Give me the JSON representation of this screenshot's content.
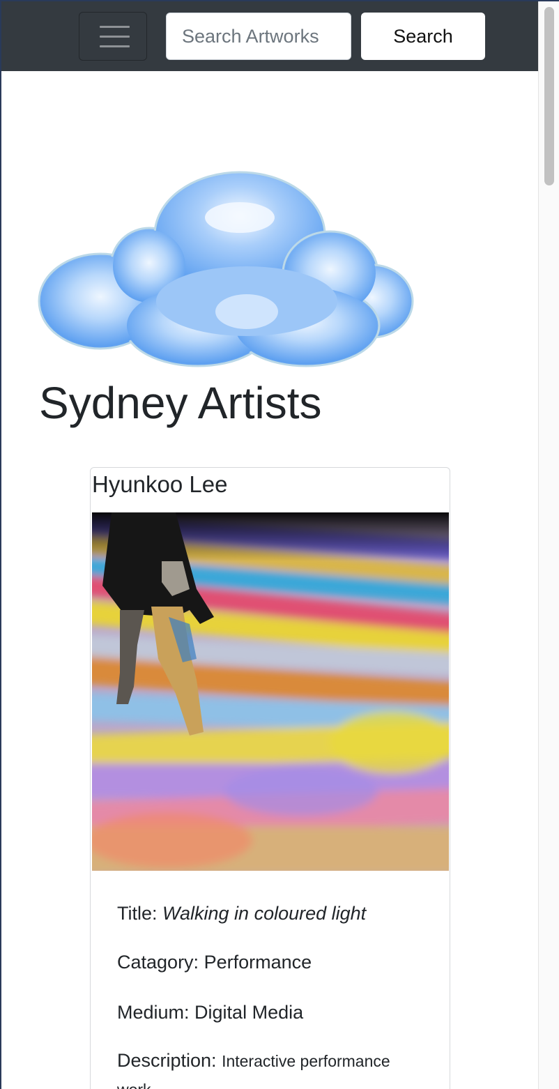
{
  "navbar": {
    "menu_toggle_label": "",
    "search_placeholder": "Search Artworks",
    "search_button_label": "Search"
  },
  "page": {
    "title": "Sydney Artists"
  },
  "artwork_card": {
    "artist_name": "Hyunkoo Lee",
    "title_label": "Title: ",
    "title_value": "Walking in coloured light",
    "category_label": "Catagory: ",
    "category_value": "Performance",
    "medium_label": "Medium: ",
    "medium_value": "Digital Media",
    "description_label": "Description: ",
    "description_value": "Interactive performance work"
  },
  "colors": {
    "navbar_bg": "#343a40",
    "cloud_blue": "#5c9ff0",
    "page_bg": "#ffffff",
    "text": "#212529"
  },
  "icons": {
    "menu": "hamburger-icon",
    "logo": "cloud-logo"
  }
}
